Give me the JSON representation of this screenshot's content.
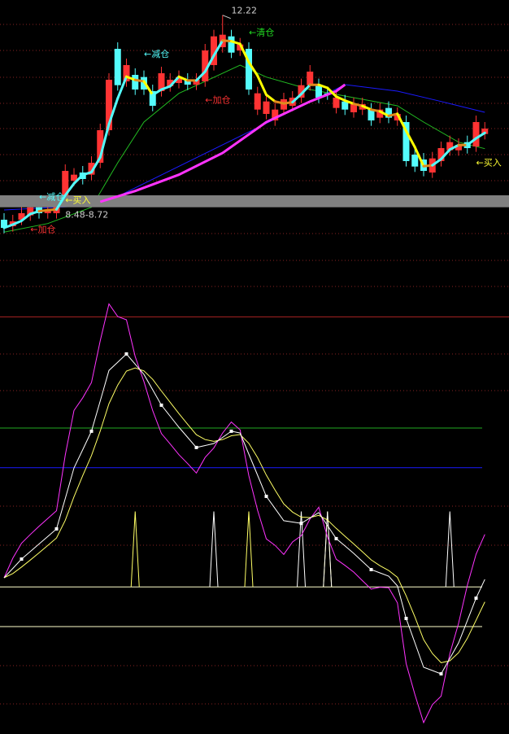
{
  "chart_data": [
    {
      "type": "candlestick",
      "title": "",
      "colors": {
        "up": "#ff3333",
        "down": "#54fcfc",
        "flat": "#ffffff",
        "band": "#808080",
        "ma_long": "#ff33ff",
        "ma_longer": "#1a1aff",
        "ma_mid": "#22bb22"
      },
      "candles": [
        [
          8.45,
          8.3
        ],
        [
          8.33,
          8.42
        ],
        [
          8.45,
          8.57
        ],
        [
          8.53,
          8.68
        ],
        [
          8.68,
          8.57
        ],
        [
          8.57,
          8.63
        ],
        [
          8.57,
          8.72
        ],
        [
          8.83,
          9.35
        ],
        [
          9.17,
          9.28
        ],
        [
          9.32,
          9.2
        ],
        [
          9.28,
          9.5
        ],
        [
          9.5,
          10.1
        ],
        [
          10.1,
          11.03
        ],
        [
          11.6,
          10.93
        ],
        [
          11.0,
          11.3
        ],
        [
          11.12,
          10.85
        ],
        [
          11.08,
          10.85
        ],
        [
          10.82,
          10.55
        ],
        [
          10.82,
          11.15
        ],
        [
          10.91,
          11.03
        ],
        [
          10.97,
          11.08
        ],
        [
          11.03,
          10.94
        ],
        [
          10.94,
          11.03
        ],
        [
          11.0,
          11.57
        ],
        [
          11.3,
          11.83
        ],
        [
          11.63,
          11.86
        ],
        [
          11.83,
          11.53
        ],
        [
          11.57,
          11.68
        ],
        [
          11.6,
          10.85
        ],
        [
          10.48,
          10.78
        ],
        [
          10.4,
          10.63
        ],
        [
          10.28,
          10.48
        ],
        [
          10.48,
          10.67
        ],
        [
          10.55,
          10.7
        ],
        [
          10.7,
          10.93
        ],
        [
          10.93,
          11.18
        ],
        [
          10.93,
          10.7
        ],
        [
          10.78,
          10.76
        ],
        [
          10.51,
          10.7
        ],
        [
          10.63,
          10.48
        ],
        [
          10.43,
          10.58
        ],
        [
          10.48,
          10.58
        ],
        [
          10.48,
          10.28
        ],
        [
          10.33,
          10.48
        ],
        [
          10.51,
          10.33
        ],
        [
          10.28,
          10.4
        ],
        [
          10.25,
          9.53
        ],
        [
          9.65,
          9.43
        ],
        [
          9.56,
          9.35
        ],
        [
          9.32,
          9.58
        ],
        [
          9.53,
          9.77
        ],
        [
          9.73,
          9.88
        ],
        [
          9.73,
          9.83
        ],
        [
          9.88,
          9.77
        ],
        [
          9.8,
          10.25
        ],
        [
          10.03,
          10.13
        ]
      ],
      "max_high": {
        "index": 25,
        "value": 12.22
      },
      "ma_long": [
        [
          11,
          8.78
        ],
        [
          15,
          8.98
        ],
        [
          20,
          9.28
        ],
        [
          25,
          9.68
        ],
        [
          30,
          10.25
        ],
        [
          35,
          10.63
        ],
        [
          38,
          10.82
        ],
        [
          39,
          10.94
        ]
      ],
      "ma_longer": [
        [
          0,
          8.63
        ],
        [
          11,
          8.72
        ],
        [
          39,
          10.94
        ],
        [
          45,
          10.82
        ],
        [
          50,
          10.63
        ],
        [
          55,
          10.43
        ]
      ],
      "ma_mid": [
        [
          0,
          8.22
        ],
        [
          5,
          8.38
        ],
        [
          10,
          8.68
        ],
        [
          13,
          9.5
        ],
        [
          16,
          10.25
        ],
        [
          20,
          10.78
        ],
        [
          23,
          11.0
        ],
        [
          27,
          11.3
        ],
        [
          30,
          11.08
        ],
        [
          35,
          10.85
        ],
        [
          40,
          10.7
        ],
        [
          45,
          10.55
        ],
        [
          48,
          10.25
        ],
        [
          52,
          9.88
        ],
        [
          55,
          9.76
        ]
      ],
      "band_range": [
        8.68,
        8.9
      ],
      "annotations": [
        {
          "index": 16,
          "price": 11.45,
          "text": "←减仓",
          "color": "#54fcfc"
        },
        {
          "index": 28,
          "price": 11.85,
          "text": "←清仓",
          "color": "#22dd22"
        },
        {
          "index": 23,
          "price": 10.6,
          "text": "←加仓",
          "color": "#ff3333"
        },
        {
          "index": 26,
          "price": 12.25,
          "text": "12.22",
          "color": "#cccccc"
        },
        {
          "index": 4,
          "price": 8.82,
          "text": "←减仓",
          "color": "#54fcfc"
        },
        {
          "index": 7,
          "price": 8.76,
          "text": "←买入",
          "color": "#ffff33"
        },
        {
          "index": 7,
          "price": 8.49,
          "text": "8.48-8.72",
          "color": "#cccccc"
        },
        {
          "index": 3,
          "price": 8.22,
          "text": "←加仓",
          "color": "#ff3333"
        },
        {
          "index": 54,
          "price": 9.45,
          "text": "←买入",
          "color": "#ffff33"
        }
      ]
    },
    {
      "type": "line",
      "title": "",
      "ylim": [
        -30,
        156
      ],
      "levels": [
        {
          "value": 156,
          "color": "#aa2222"
        },
        {
          "value": 100,
          "color": "#22aa22"
        },
        {
          "value": 80,
          "color": "#1a1aff"
        },
        {
          "value": 20,
          "color": "#ffffcc"
        },
        {
          "value": 0,
          "color": "#ffffcc"
        }
      ],
      "k_points": [
        [
          0,
          24.6
        ],
        [
          2,
          34
        ],
        [
          6,
          49.2
        ],
        [
          8,
          79.9
        ],
        [
          10,
          98.4
        ],
        [
          12,
          129
        ],
        [
          14,
          137.3
        ],
        [
          16,
          127
        ],
        [
          18,
          111.5
        ],
        [
          20,
          100.4
        ],
        [
          22,
          90.2
        ],
        [
          24,
          92.2
        ],
        [
          26,
          98.4
        ],
        [
          27,
          97.5
        ],
        [
          30,
          65.6
        ],
        [
          32,
          53.3
        ],
        [
          34,
          52
        ],
        [
          36,
          57.4
        ],
        [
          38,
          44.3
        ],
        [
          40,
          36.9
        ],
        [
          42,
          28.7
        ],
        [
          44,
          25.4
        ],
        [
          45,
          20.5
        ],
        [
          46,
          4.1
        ],
        [
          48,
          -20.5
        ],
        [
          50,
          -23.8
        ],
        [
          52,
          -8.2
        ],
        [
          54,
          14.3
        ],
        [
          55,
          23.8
        ]
      ],
      "signals": [
        {
          "index": 15,
          "color": "#ffff66"
        },
        {
          "index": 24,
          "color": "#ffffff"
        },
        {
          "index": 28,
          "color": "#ffff66"
        },
        {
          "index": 34,
          "color": "#ffffff"
        },
        {
          "index": 37,
          "color": "#ffff66"
        },
        {
          "index": 37,
          "color": "#ffffff"
        },
        {
          "index": 51,
          "color": "#ffffff"
        }
      ],
      "signal_range": [
        20,
        58
      ],
      "series_colors": {
        "K": "#ffffff",
        "D": "#ffff66",
        "J": "#ff33ff"
      }
    }
  ]
}
